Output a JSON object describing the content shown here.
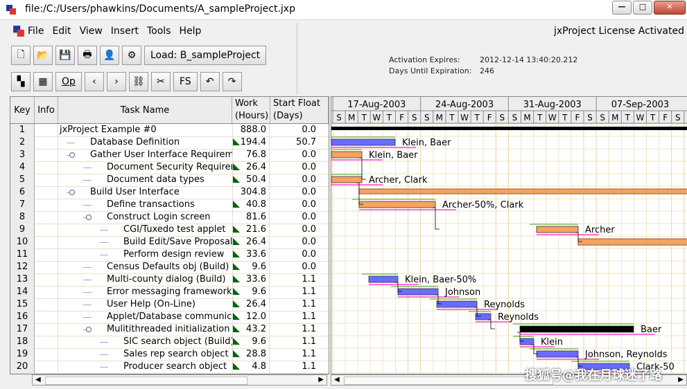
{
  "window": {
    "title": "file:/C:/Users/phawkins/Documents/A_sampleProject.jxp",
    "min": "—",
    "max": "□",
    "close": "✕"
  },
  "menu": [
    "File",
    "Edit",
    "View",
    "Insert",
    "Tools",
    "Help"
  ],
  "toolbar": {
    "load_label": "Load: B_sampleProject",
    "op_label": "Op",
    "fs_label": "FS"
  },
  "license": {
    "title": "jxProject License Activated",
    "expires_label": "Activation Expires:",
    "expires_value": "2012-12-14 13:40:20.212",
    "days_label": "Days Until Expiration:",
    "days_value": "246"
  },
  "columns": {
    "key": "Key",
    "info": "Info",
    "name": "Task Name",
    "work1": "Work",
    "work2": "(Hours)",
    "float1": "Start Float",
    "float2": "(Days)"
  },
  "rows": [
    {
      "key": "1",
      "name": "jxProject Example #0",
      "level": 0,
      "work": "888.0",
      "float": "0.0",
      "tri": false
    },
    {
      "key": "2",
      "name": "Database Definition",
      "level": 1,
      "work": "194.4",
      "float": "50.7",
      "tri": true
    },
    {
      "key": "3",
      "name": "Gather User Interface Requirements",
      "level": 1,
      "work": "76.8",
      "float": "0.0",
      "tri": false,
      "group": true
    },
    {
      "key": "4",
      "name": "Document Security Requirements",
      "level": 2,
      "work": "26.4",
      "float": "0.0",
      "tri": true
    },
    {
      "key": "5",
      "name": "Document data types",
      "level": 2,
      "work": "50.4",
      "float": "0.0",
      "tri": true
    },
    {
      "key": "6",
      "name": "Build User Interface",
      "level": 1,
      "work": "304.8",
      "float": "0.0",
      "tri": false,
      "group": true
    },
    {
      "key": "7",
      "name": "Define transactions",
      "level": 2,
      "work": "40.8",
      "float": "0.0",
      "tri": true
    },
    {
      "key": "8",
      "name": "Construct Login screen",
      "level": 2,
      "work": "81.6",
      "float": "0.0",
      "tri": false,
      "group": true
    },
    {
      "key": "9",
      "name": "CGI/Tuxedo test applet",
      "level": 3,
      "work": "21.6",
      "float": "0.0",
      "tri": true
    },
    {
      "key": "10",
      "name": "Build Edit/Save Proposal screen",
      "level": 3,
      "work": "26.4",
      "float": "0.0",
      "tri": true
    },
    {
      "key": "11",
      "name": "Perform design review",
      "level": 3,
      "work": "33.6",
      "float": "0.0",
      "tri": true
    },
    {
      "key": "12",
      "name": "Census Defaults obj (Build)",
      "level": 2,
      "work": "9.6",
      "float": "0.0",
      "tri": true
    },
    {
      "key": "13",
      "name": "Multi-county dialog (Build)",
      "level": 2,
      "work": "33.6",
      "float": "1.1",
      "tri": true
    },
    {
      "key": "14",
      "name": "Error messaging framework",
      "level": 2,
      "work": "9.6",
      "float": "1.1",
      "tri": true
    },
    {
      "key": "15",
      "name": "User Help (On-Line)",
      "level": 2,
      "work": "26.4",
      "float": "1.1",
      "tri": true
    },
    {
      "key": "16",
      "name": "Applet/Database communication",
      "level": 2,
      "work": "12.0",
      "float": "1.1",
      "tri": true
    },
    {
      "key": "17",
      "name": "Mulitithreaded initialization dow",
      "level": 2,
      "work": "43.2",
      "float": "1.1",
      "tri": true,
      "group": true
    },
    {
      "key": "18",
      "name": "SIC search object (Build)",
      "level": 3,
      "work": "9.6",
      "float": "1.1",
      "tri": true
    },
    {
      "key": "19",
      "name": "Sales rep search object",
      "level": 3,
      "work": "28.8",
      "float": "1.1",
      "tri": true
    },
    {
      "key": "20",
      "name": "Producer search object",
      "level": 3,
      "work": "4.8",
      "float": "1.1",
      "tri": true
    }
  ],
  "timeline": {
    "weeks": [
      "17-Aug-2003",
      "24-Aug-2003",
      "31-Aug-2003",
      "07-Sep-2003"
    ],
    "days": [
      "S",
      "M",
      "T",
      "W",
      "T",
      "F",
      "S"
    ]
  },
  "bars": [
    {
      "row": 2,
      "label": "Klein, Baer",
      "style": "blue"
    },
    {
      "row": 3,
      "label": "Klein, Baer",
      "style": "orange"
    },
    {
      "row": 5,
      "label": "Archer, Clark",
      "style": "orange"
    },
    {
      "row": 7,
      "label": "Archer-50%, Clark",
      "style": "orange"
    },
    {
      "row": 9,
      "label": "Archer",
      "style": "orange"
    },
    {
      "row": 13,
      "label": "Klein, Baer-50%",
      "style": "blue"
    },
    {
      "row": 14,
      "label": "Johnson",
      "style": "blue"
    },
    {
      "row": 15,
      "label": "Reynolds",
      "style": "blue"
    },
    {
      "row": 16,
      "label": "Reynolds",
      "style": "blue"
    },
    {
      "row": 17,
      "label": "Baer",
      "style": "black"
    },
    {
      "row": 18,
      "label": "Klein",
      "style": "blue"
    },
    {
      "row": 19,
      "label": "Johnson, Reynolds",
      "style": "blue"
    },
    {
      "row": 20,
      "label": "Clark-50",
      "style": "blue"
    }
  ],
  "watermark": "搜狐号@我在月球迷了路",
  "colors": {
    "orange": "#f4a460",
    "blue": "#6b6bff",
    "black": "#000000",
    "pink": "#ff44cc",
    "green": "#44aa22"
  }
}
